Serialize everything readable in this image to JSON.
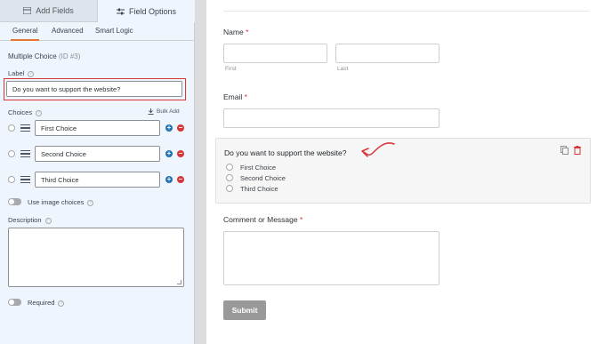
{
  "left_panel": {
    "tabs": {
      "add_fields": "Add Fields",
      "field_options": "Field Options"
    },
    "subtabs": [
      "General",
      "Advanced",
      "Smart Logic"
    ],
    "field_type": "Multiple Choice",
    "field_id": "(ID #3)",
    "label_heading": "Label",
    "label_value": "Do you want to support the website?",
    "choices_heading": "Choices",
    "bulk_add": "Bulk Add",
    "choices": [
      "First Choice",
      "Second Choice",
      "Third Choice"
    ],
    "use_image_choices": "Use image choices",
    "description_heading": "Description",
    "required": "Required"
  },
  "form": {
    "name_label": "Name",
    "first_sublabel": "First",
    "last_sublabel": "Last",
    "email_label": "Email",
    "question": "Do you want to support the website?",
    "options": [
      "First Choice",
      "Second Choice",
      "Third Choice"
    ],
    "comment_label": "Comment or Message",
    "required_mark": "*",
    "submit": "Submit"
  },
  "colors": {
    "accent_orange": "#e27730",
    "highlight_red": "#d63638",
    "add_blue": "#2271b1"
  }
}
